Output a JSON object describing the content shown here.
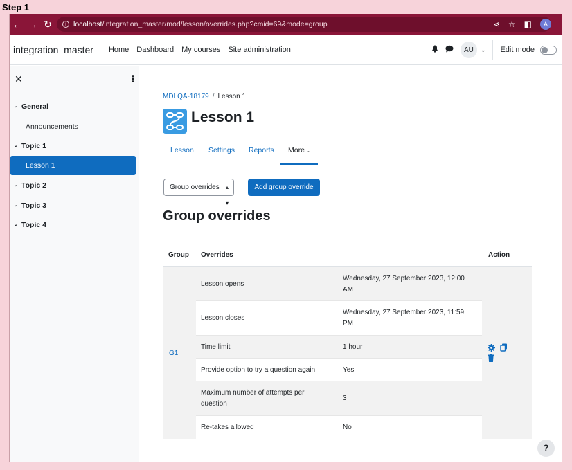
{
  "step_label": "Step 1",
  "browser": {
    "url_host": "localhost",
    "url_path": "/integration_master/mod/lesson/overrides.php?cmid=69&mode=group",
    "profile_initial": "A"
  },
  "navbar": {
    "brand": "integration_master",
    "links": [
      "Home",
      "Dashboard",
      "My courses",
      "Site administration"
    ],
    "user_initials": "AU",
    "edit_mode_label": "Edit mode"
  },
  "drawer": {
    "items": [
      {
        "label": "General",
        "type": "section"
      },
      {
        "label": "Announcements",
        "type": "activity"
      },
      {
        "label": "Topic 1",
        "type": "section"
      },
      {
        "label": "Lesson 1",
        "type": "activity",
        "active": true
      },
      {
        "label": "Topic 2",
        "type": "section"
      },
      {
        "label": "Topic 3",
        "type": "section"
      },
      {
        "label": "Topic 4",
        "type": "section"
      }
    ]
  },
  "breadcrumb": {
    "course": "MDLQA-18179",
    "current": "Lesson 1"
  },
  "page_title": "Lesson 1",
  "tabs": [
    "Lesson",
    "Settings",
    "Reports",
    "More"
  ],
  "active_tab": "More",
  "override_select": "Group overrides",
  "add_button": "Add group override",
  "section_heading": "Group overrides",
  "table": {
    "headers": {
      "group": "Group",
      "overrides": "Overrides",
      "action": "Action"
    },
    "group": "G1",
    "rows": [
      {
        "setting": "Lesson opens",
        "value": "Wednesday, 27 September 2023, 12:00 AM"
      },
      {
        "setting": "Lesson closes",
        "value": "Wednesday, 27 September 2023, 11:59 PM"
      },
      {
        "setting": "Time limit",
        "value": "1 hour"
      },
      {
        "setting": "Provide option to try a question again",
        "value": "Yes"
      },
      {
        "setting": "Maximum number of attempts per question",
        "value": "3"
      },
      {
        "setting": "Re-takes allowed",
        "value": "No"
      }
    ]
  },
  "help_label": "?",
  "colors": {
    "accent": "#0f6cbf",
    "browser_bar": "#8a1538",
    "lesson_icon": "#399be2"
  }
}
